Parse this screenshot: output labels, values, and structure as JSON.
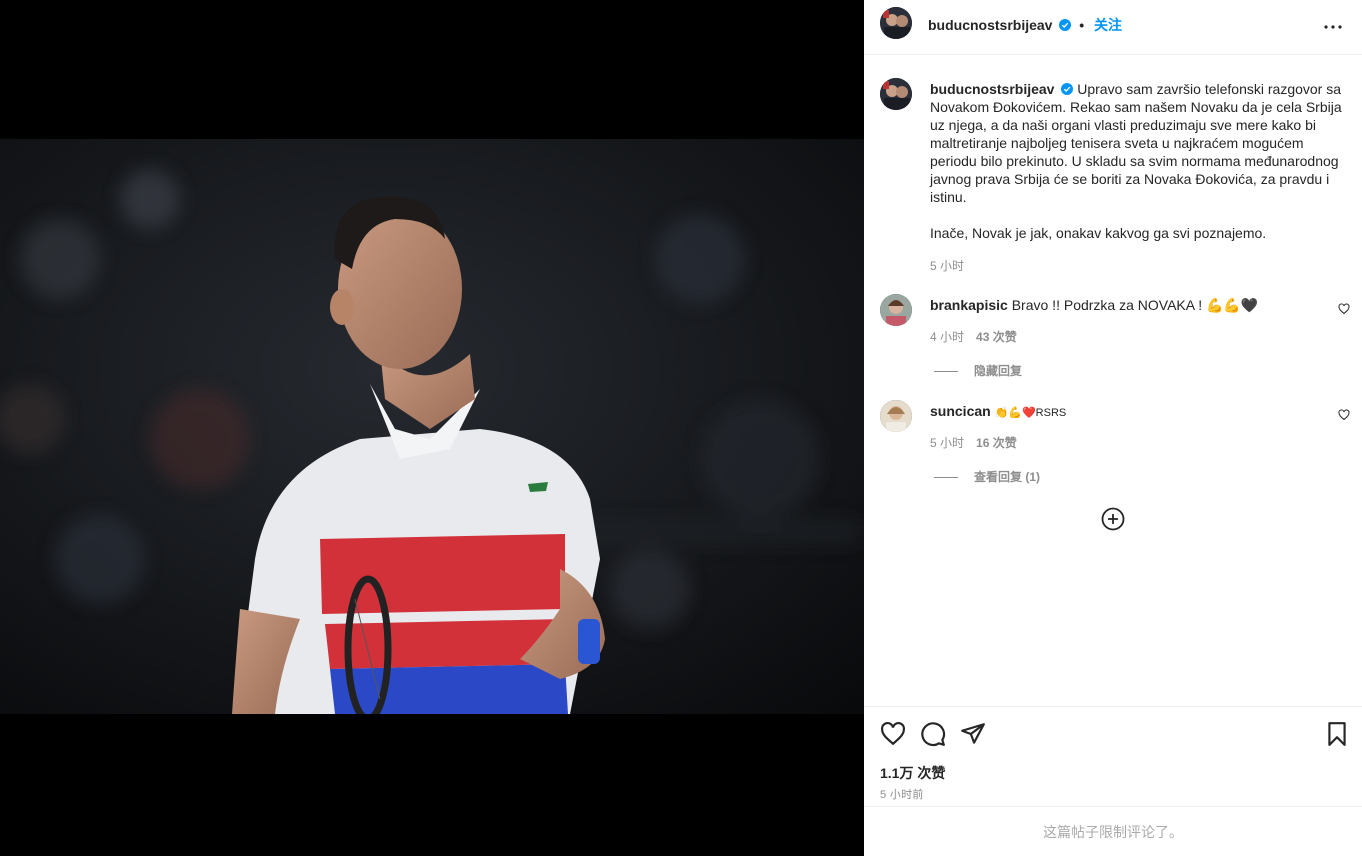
{
  "post": {
    "username": "buducnostsrbijeav",
    "follow_label": "关注",
    "caption_p1": "Upravo sam završio telefonski razgovor sa Novakom Đokovićem. Rekao sam našem Novaku da je cela Srbija uz njega, a da naši organi vlasti preduzimaju sve mere kako bi maltretiranje najboljeg tenisera sveta u najkraćem mogućem periodu bilo prekinuto. U skladu sa svim normama međunarodnog javnog prava Srbija će se boriti za Novaka Đokovića, za pravdu i istinu.",
    "caption_p2": "Inače, Novak je jak, onakav kakvog ga svi poznajemo.",
    "caption_time": "5 小时"
  },
  "comments": [
    {
      "username": "brankapisic",
      "text": "Bravo !! Podrzka za NOVAKA ! 💪💪🖤",
      "time": "4 小时",
      "likes": "43 次赞",
      "reply_toggle": "隐藏回复"
    },
    {
      "username": "suncican",
      "text": "👏💪❤️RSRS",
      "time": "5 小时",
      "likes": "16 次赞",
      "reply_toggle": "查看回复 (1)"
    }
  ],
  "stats": {
    "likes": "1.1万 次赞",
    "posted": "5 小时前"
  },
  "footer": {
    "restricted": "这篇帖子限制评论了。"
  },
  "icons": [
    "more-icon",
    "verified-icon",
    "heart-icon",
    "comment-icon",
    "share-icon",
    "bookmark-icon",
    "add-circle-icon"
  ],
  "colors": {
    "accent": "#0095f6",
    "muted": "#8e8e8e",
    "text": "#262626"
  }
}
